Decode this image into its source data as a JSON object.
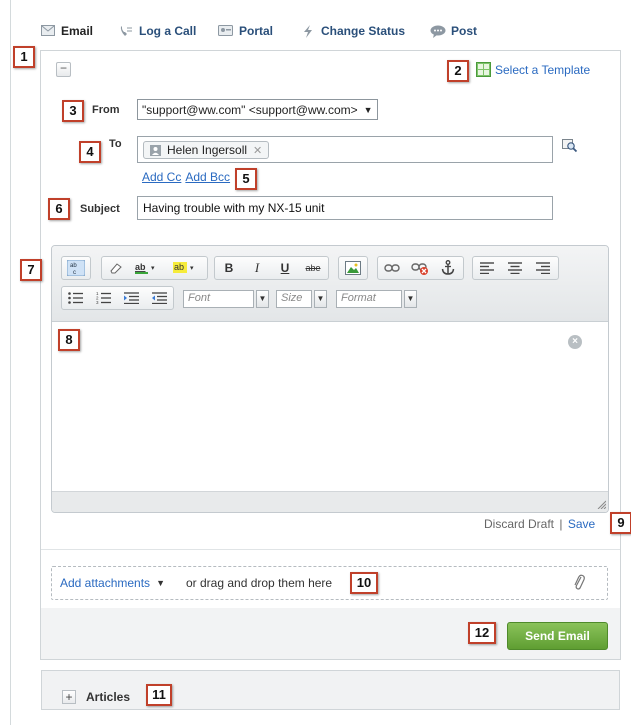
{
  "tabs": [
    {
      "label": "Email",
      "icon": "email-icon"
    },
    {
      "label": "Log a Call",
      "icon": "phone-icon"
    },
    {
      "label": "Portal",
      "icon": "portal-icon"
    },
    {
      "label": "Change Status",
      "icon": "lightning-icon"
    },
    {
      "label": "Post",
      "icon": "chat-bubble-icon"
    }
  ],
  "template_link": "Select a Template",
  "form": {
    "from_label": "From",
    "from_value": "\"support@ww.com\" <support@ww.com>",
    "to_label": "To",
    "to_recipient": "Helen Ingersoll",
    "add_cc": "Add Cc",
    "add_bcc": "Add Bcc",
    "subject_label": "Subject",
    "subject_value": "Having trouble with my NX-15 unit"
  },
  "toolbar": {
    "font_placeholder": "Font",
    "size_placeholder": "Size",
    "format_placeholder": "Format"
  },
  "draft": {
    "discard": "Discard Draft",
    "separator": "|",
    "save": "Save"
  },
  "attachments": {
    "add_label": "Add attachments",
    "drop_text": "or drag and drop them here"
  },
  "send_button": "Send Email",
  "articles_label": "Articles",
  "callouts": [
    "1",
    "2",
    "3",
    "4",
    "5",
    "6",
    "7",
    "8",
    "9",
    "10",
    "11",
    "12"
  ],
  "colors": {
    "link": "#2a6ac1",
    "send_button": "#6aa83c",
    "callout_border": "#c0402a"
  }
}
